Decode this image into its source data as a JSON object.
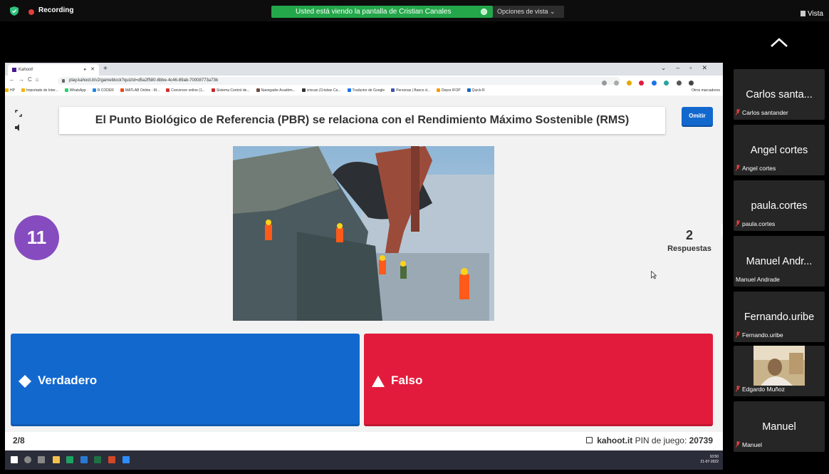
{
  "zoom": {
    "recording_label": "Recording",
    "viewing_banner": "Usted está viendo la pantalla de Cristian Canales",
    "view_options": "Opciones de vista ⌄",
    "vista_label": "Vista"
  },
  "browser": {
    "tab_title": "Kahoot!",
    "url": "play.kahoot.it/v2/gameblock?quizId=d5a2f580-8bbe-4c46-89ab-70008773a73b",
    "bookmarks": [
      "HP",
      "Importado de Inter...",
      "WhatsApp",
      "R CODER",
      "MATLAB Online - M...",
      "Conversor online (1...",
      "Sistema Control de...",
      "Navegador Académ...",
      "criscan (Cristian Ca...",
      "Traductor de Google",
      "Personas | Banco d...",
      "Depor IFOP",
      "Quick-R"
    ],
    "other_bookmarks": "Otros marcadores"
  },
  "kahoot": {
    "question": "El Punto Biológico de Referencia (PBR) se relaciona con el Rendimiento Máximo Sostenible (RMS)",
    "skip_label": "Omitir",
    "timer": "11",
    "answers_count": "2",
    "answers_label": "Respuestas",
    "answer_true": "Verdadero",
    "answer_false": "Falso",
    "progress": "2/8",
    "site": "kahoot.it",
    "pin_label": "PIN de juego:",
    "pin": "20739",
    "colors": {
      "blue": "#1368ce",
      "red": "#e21b3c",
      "purple": "#864cbf"
    }
  },
  "taskbar": {
    "time": "10:50",
    "date": "21-07-2022"
  },
  "participants": [
    {
      "name": "Carlos santa...",
      "tag": "Carlos santander",
      "muted": true
    },
    {
      "name": "Angel cortes",
      "tag": "Angel cortes",
      "muted": true
    },
    {
      "name": "paula.cortes",
      "tag": "paula.cortes",
      "muted": true
    },
    {
      "name": "Manuel Andr...",
      "tag": "Manuel Andrade",
      "muted": false
    },
    {
      "name": "Fernando.uribe",
      "tag": "Fernando.uribe",
      "muted": true
    },
    {
      "name": "",
      "tag": "Edgardo Muñoz",
      "muted": true,
      "video": true
    },
    {
      "name": "Manuel",
      "tag": "Manuel",
      "muted": true
    }
  ]
}
